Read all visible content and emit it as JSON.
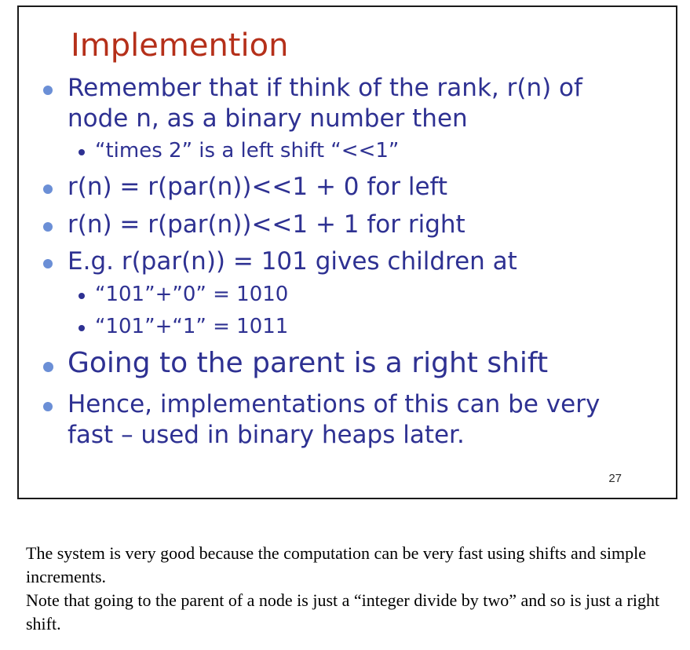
{
  "slide": {
    "title": "Implemention",
    "page_number": "27",
    "bullets": [
      {
        "line1": "Remember that if think of the rank, r(n) of",
        "line2": "node n, as a binary number then"
      },
      {
        "text": "“times 2” is a left shift “<<1”"
      },
      {
        "text": "r(n) = r(par(n))<<1 + 0 for left"
      },
      {
        "text": "r(n) = r(par(n))<<1 + 1 for right"
      },
      {
        "text": "E.g. r(par(n)) = 101 gives children at"
      },
      {
        "text": "“101”+”0” = 1010"
      },
      {
        "text": "“101”+“1” = 1011"
      },
      {
        "text": "Going to the parent is a right shift"
      },
      {
        "line1": "Hence, implementations of this can be very",
        "line2": "fast – used in binary heaps later."
      }
    ]
  },
  "notes": {
    "paragraph1": "The system is very good because the computation can be very fast using shifts and simple increments.",
    "paragraph2": "Note that going to the parent of a node is just a “integer divide by two” and so is just a right shift."
  }
}
